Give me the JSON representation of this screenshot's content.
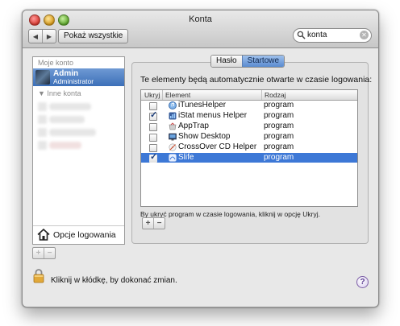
{
  "window": {
    "title": "Konta",
    "nav_back": "◀",
    "nav_forward": "▶",
    "show_all_label": "Pokaż wszystkie",
    "search_value": "konta",
    "search_clear": "✕"
  },
  "sidebar": {
    "my_account_label": "Moje konto",
    "current_user": {
      "name": "Admin",
      "role": "Administrator"
    },
    "other_accounts_label": "Inne konta",
    "login_options_label": "Opcje logowania",
    "add_label": "+",
    "remove_label": "−"
  },
  "tabs": {
    "password_label": "Hasło",
    "startup_label": "Startowe",
    "active": "Startowe"
  },
  "startup": {
    "description": "Te elementy będą automatycznie otwarte w czasie logowania:",
    "columns": [
      "Ukryj",
      "Element",
      "Rodzaj"
    ],
    "items": [
      {
        "hide": false,
        "name": "iTunesHelper",
        "kind": "program",
        "icon": "itunes-icon",
        "selected": false
      },
      {
        "hide": true,
        "name": "iStat menus Helper",
        "kind": "program",
        "icon": "istat-icon",
        "selected": false
      },
      {
        "hide": false,
        "name": "AppTrap",
        "kind": "program",
        "icon": "apptrap-icon",
        "selected": false
      },
      {
        "hide": false,
        "name": "Show Desktop",
        "kind": "program",
        "icon": "show-desktop-icon",
        "selected": false
      },
      {
        "hide": false,
        "name": "CrossOver CD Helper",
        "kind": "program",
        "icon": "crossover-icon",
        "selected": false
      },
      {
        "hide": true,
        "name": "Slife",
        "kind": "program",
        "icon": "slife-icon",
        "selected": true
      }
    ],
    "hint": "By ukryć program w czasie logowania, kliknij w opcję Ukryj.",
    "add_label": "+",
    "remove_label": "−"
  },
  "footer": {
    "lock_text": "Kliknij w kłódkę, by dokonać zmian.",
    "help_label": "?"
  },
  "colors": {
    "selection": "#3d78d6",
    "sidebar_selection": "#4a7cc2"
  }
}
